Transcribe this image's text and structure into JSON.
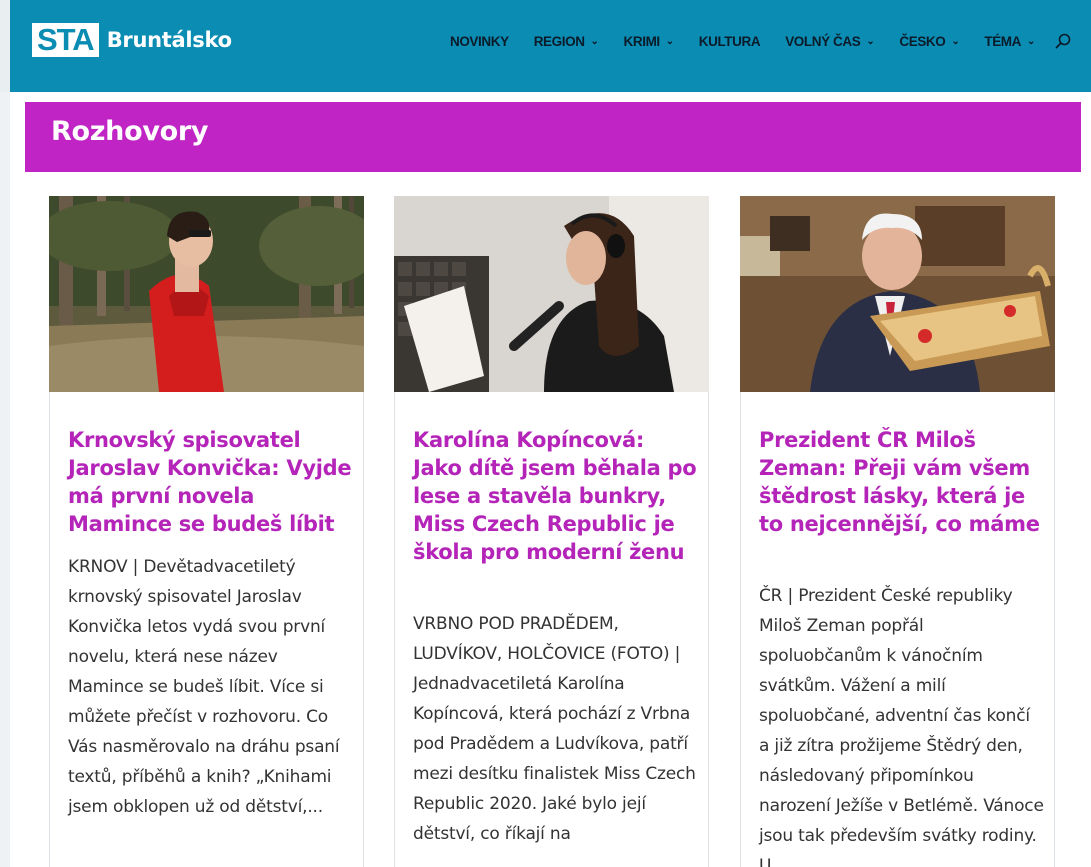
{
  "header": {
    "logo_box": "STA",
    "logo_text": "Bruntálsko",
    "nav": [
      {
        "label": "NOVINKY",
        "dropdown": false
      },
      {
        "label": "REGION",
        "dropdown": true
      },
      {
        "label": "KRIMI",
        "dropdown": true
      },
      {
        "label": "KULTURA",
        "dropdown": false
      },
      {
        "label": "VOLNÝ ČAS",
        "dropdown": true
      },
      {
        "label": "ČESKO",
        "dropdown": true
      },
      {
        "label": "TÉMA",
        "dropdown": true
      }
    ],
    "search_icon": "search-icon"
  },
  "section": {
    "title": "Rozhovory"
  },
  "articles": [
    {
      "title": "Krnovský spisovatel Jaroslav Konvička: Vyjde má první novela Mamince se budeš líbit",
      "excerpt": "KRNOV | Devětadvacetiletý krnovský spisovatel Jaroslav Konvička letos vydá svou první novelu, která nese název Mamince se budeš líbit. Více si můžete přečíst v rozhovoru. Co Vás nasměrovalo na dráhu psaní textů, příběhů a knih? „Knihami jsem obklopen už od dětství,..."
    },
    {
      "title": "Karolína Kopíncová: Jako dítě jsem běhala po lese a stavěla bunkry, Miss Czech Republic je škola pro moderní ženu",
      "excerpt": "VRBNO POD PRADĚDEM, LUDVÍKOV, HOLČOVICE (FOTO) | Jednadvacetiletá Karolína Kopíncová, která pochází z Vrbna pod Pradědem a Ludvíkova, patří mezi desítku finalistek Miss Czech Republic 2020. Jaké bylo její dětství, co říkají na"
    },
    {
      "title": "Prezident ČR Miloš Zeman: Přeji vám všem štědrost lásky, která je to nejcennější, co máme",
      "excerpt": "ČR | Prezident České republiky Miloš Zeman popřál spoluobčanům k vánočním svátkům. Vážení a milí spoluobčané, adventní čas končí a již zítra prožijeme Štědrý den, následovaný připomínkou narození Ježíše v Betlémě. Vánoce jsou tak především svátky rodiny. U..."
    }
  ],
  "colors": {
    "header_bg": "#0a8cb3",
    "section_bg": "#c024c4",
    "title_color": "#b424b8"
  }
}
